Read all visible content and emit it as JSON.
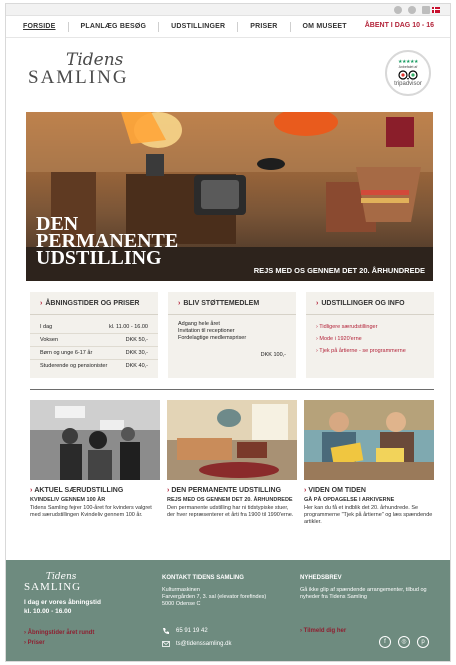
{
  "nav": {
    "items": [
      "FORSIDE",
      "PLANLÆG BESØG",
      "UDSTILLINGER",
      "PRISER",
      "OM MUSEET"
    ],
    "hours": "ÅBENT I DAG 10 - 16"
  },
  "logo": {
    "line1": "Tidens",
    "line2": "SAMLING"
  },
  "tripadvisor": {
    "stars": "★★★★★",
    "caption": "Anbefalet af",
    "name": "tripadvisor"
  },
  "hero": {
    "title_lines": [
      "DEN",
      "PERMANENTE",
      "UDSTILLING"
    ],
    "subtitle": "REJS MED OS GENNEM DET 20. ÅRHUNDREDE"
  },
  "boxes": {
    "hours": {
      "title": "ÅBNINGSTIDER OG PRISER",
      "rows": [
        {
          "label": "I dag",
          "value": "kl. 11.00 - 16.00"
        },
        {
          "label": "Voksen",
          "value": "DKK 50,-"
        },
        {
          "label": "Børn og unge 6-17 år",
          "value": "DKK 30,-"
        },
        {
          "label": "Studerende og pensionister",
          "value": "DKK 40,-"
        }
      ]
    },
    "support": {
      "title": "BLIV STØTTEMEDLEM",
      "lines": [
        "Adgang hele året",
        "Invitation til receptioner",
        "Fordelagtige medlemspriser"
      ],
      "price": "DKK 100,-"
    },
    "exhibitions": {
      "title": "UDSTILLINGER OG INFO",
      "links": [
        "› Tidligere særudstillinger",
        "› Mode i 1920'erne",
        "› Tjek på årtierne - se programmerne"
      ]
    }
  },
  "tiles": [
    {
      "title": "AKTUEL SÆRUDSTILLING",
      "kicker": "KVINDELIV GENNEM 100 ÅR",
      "body": "Tidens Samling fejrer 100-året for kvinders valgret med særudstillingen Kvindeliv gennem 100 år."
    },
    {
      "title": "DEN PERMANENTE UDSTILLING",
      "kicker": "REJS MED OS GENNEM DET 20. ÅRHUNDREDE",
      "body": "Den permanente udstilling har ni tidstypiske stuer, der hver repræsenterer et årti fra 1900 til 1990'erne."
    },
    {
      "title": "VIDEN OM TIDEN",
      "kicker": "GÅ PÅ OPDAGELSE I ARKIVERNE",
      "body": "Her kan du få et indblik det 20. århundrede. Se programmerne \"Tjek på årtierne\" og læs spændende artikler."
    }
  ],
  "footer": {
    "logo1": "Tidens",
    "logo2": "SAMLING",
    "open_lines": [
      "I dag er vores åbningstid",
      "kl. 10.00 - 16.00"
    ],
    "links": [
      "› Åbningstider året rundt",
      "› Priser"
    ],
    "contact_title": "KONTAKT TIDENS SAMLING",
    "address": [
      "Kulturmaskinen",
      "Farvergården 7, 3. sal (elevator forefindes)",
      "5000 Odense C"
    ],
    "phone": "65 91 19 42",
    "email": "ts@tidenssamling.dk",
    "news_title": "NYHEDSBREV",
    "news_text": "Gå ikke glip af spændende arrangementer, tilbud og nyheder fra Tidens Samling",
    "news_link": "› Tilmeld dig her",
    "social": [
      "f",
      "◎",
      "p"
    ]
  }
}
